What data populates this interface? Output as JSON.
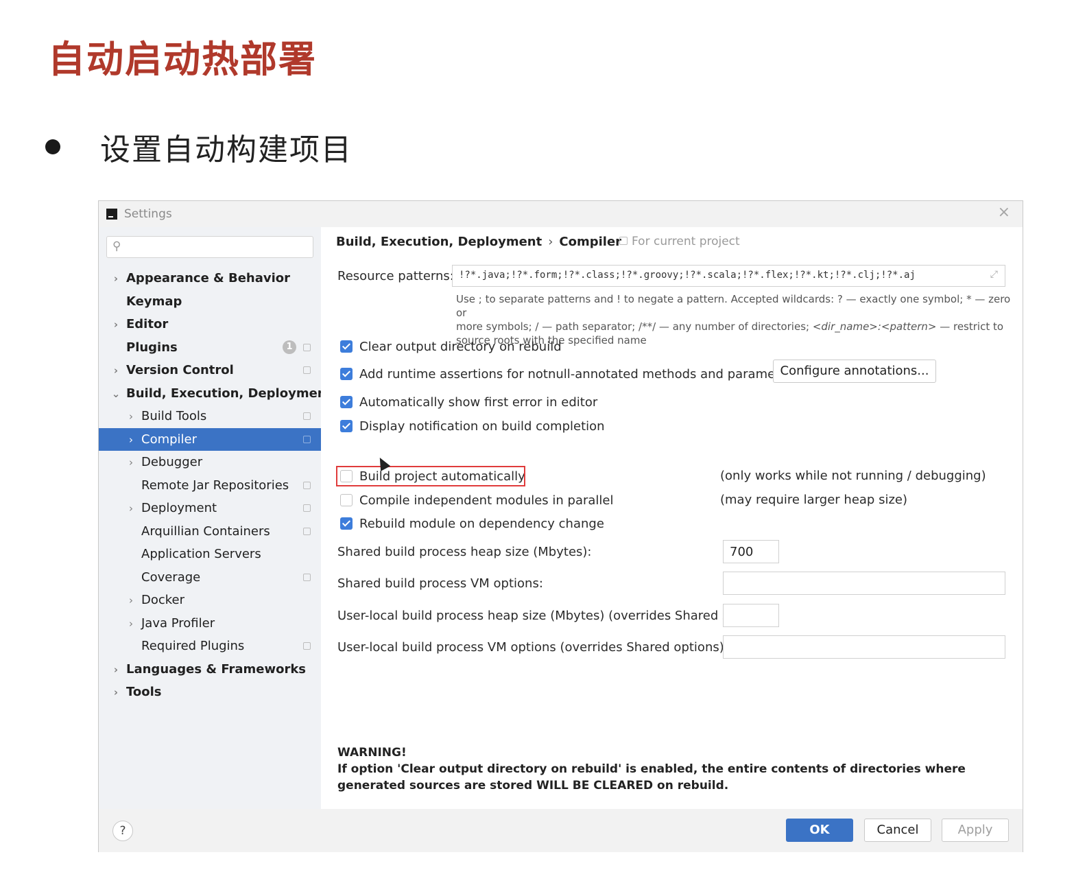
{
  "slide": {
    "title": "自动启动热部署",
    "bullet": "设置自动构建项目"
  },
  "window": {
    "title": "Settings",
    "close": "×"
  },
  "sidebar": {
    "search_placeholder": "",
    "plugins_badge": "1",
    "items": [
      {
        "label": "Appearance & Behavior"
      },
      {
        "label": "Keymap"
      },
      {
        "label": "Editor"
      },
      {
        "label": "Plugins"
      },
      {
        "label": "Version Control"
      },
      {
        "label": "Build, Execution, Deployment"
      },
      {
        "label": "Build Tools"
      },
      {
        "label": "Compiler"
      },
      {
        "label": "Debugger"
      },
      {
        "label": "Remote Jar Repositories"
      },
      {
        "label": "Deployment"
      },
      {
        "label": "Arquillian Containers"
      },
      {
        "label": "Application Servers"
      },
      {
        "label": "Coverage"
      },
      {
        "label": "Docker"
      },
      {
        "label": "Java Profiler"
      },
      {
        "label": "Required Plugins"
      },
      {
        "label": "Languages & Frameworks"
      },
      {
        "label": "Tools"
      }
    ]
  },
  "content": {
    "breadcrumb_parent": "Build, Execution, Deployment",
    "breadcrumb_sep": "›",
    "breadcrumb_current": "Compiler",
    "for_current_project": "For current project",
    "resource_patterns_label": "Resource patterns:",
    "resource_patterns_value": "!?*.java;!?*.form;!?*.class;!?*.groovy;!?*.scala;!?*.flex;!?*.kt;!?*.clj;!?*.aj",
    "hint_1": "Use ; to separate patterns and ! to negate a pattern. Accepted wildcards: ? — exactly one symbol; * — zero or",
    "hint_2a": "more symbols; / — path separator; /**/ — any number of directories; ",
    "hint_2b": "<dir_name>:<pattern>",
    "hint_2c": " — restrict to",
    "hint_3": "source roots with the specified name",
    "options": {
      "clear_output": {
        "label": "Clear output directory on rebuild",
        "checked": true
      },
      "runtime_assertions": {
        "label": "Add runtime assertions for notnull-annotated methods and parameters",
        "checked": true
      },
      "show_first_error": {
        "label": "Automatically show first error in editor",
        "checked": true
      },
      "build_notification": {
        "label": "Display notification on build completion",
        "checked": true
      },
      "build_auto": {
        "label": "Build project automatically",
        "checked": false
      },
      "parallel": {
        "label": "Compile independent modules in parallel",
        "checked": false
      },
      "rebuild_dep": {
        "label": "Rebuild module on dependency change",
        "checked": true
      }
    },
    "configure_annotations": "Configure annotations...",
    "build_auto_note": "(only works while not running / debugging)",
    "parallel_note": "(may require larger heap size)",
    "shared_heap_label": "Shared build process heap size (Mbytes):",
    "shared_heap_value": "700",
    "shared_vm_label": "Shared build process VM options:",
    "shared_vm_value": "",
    "local_heap_label": "User-local build process heap size (Mbytes) (overrides Shared size):",
    "local_heap_value": "",
    "local_vm_label": "User-local build process VM options (overrides Shared options):",
    "local_vm_value": "",
    "warning_title": "WARNING!",
    "warning_body": "If option 'Clear output directory on rebuild' is enabled, the entire contents of directories where generated sources are stored WILL BE CLEARED on rebuild."
  },
  "footer": {
    "help": "?",
    "ok": "OK",
    "cancel": "Cancel",
    "apply": "Apply"
  },
  "colors": {
    "title_red": "#b0392b",
    "selection_blue": "#3b73c5",
    "checkbox_blue": "#3d7ddb",
    "highlight_red": "#e03b3b"
  }
}
